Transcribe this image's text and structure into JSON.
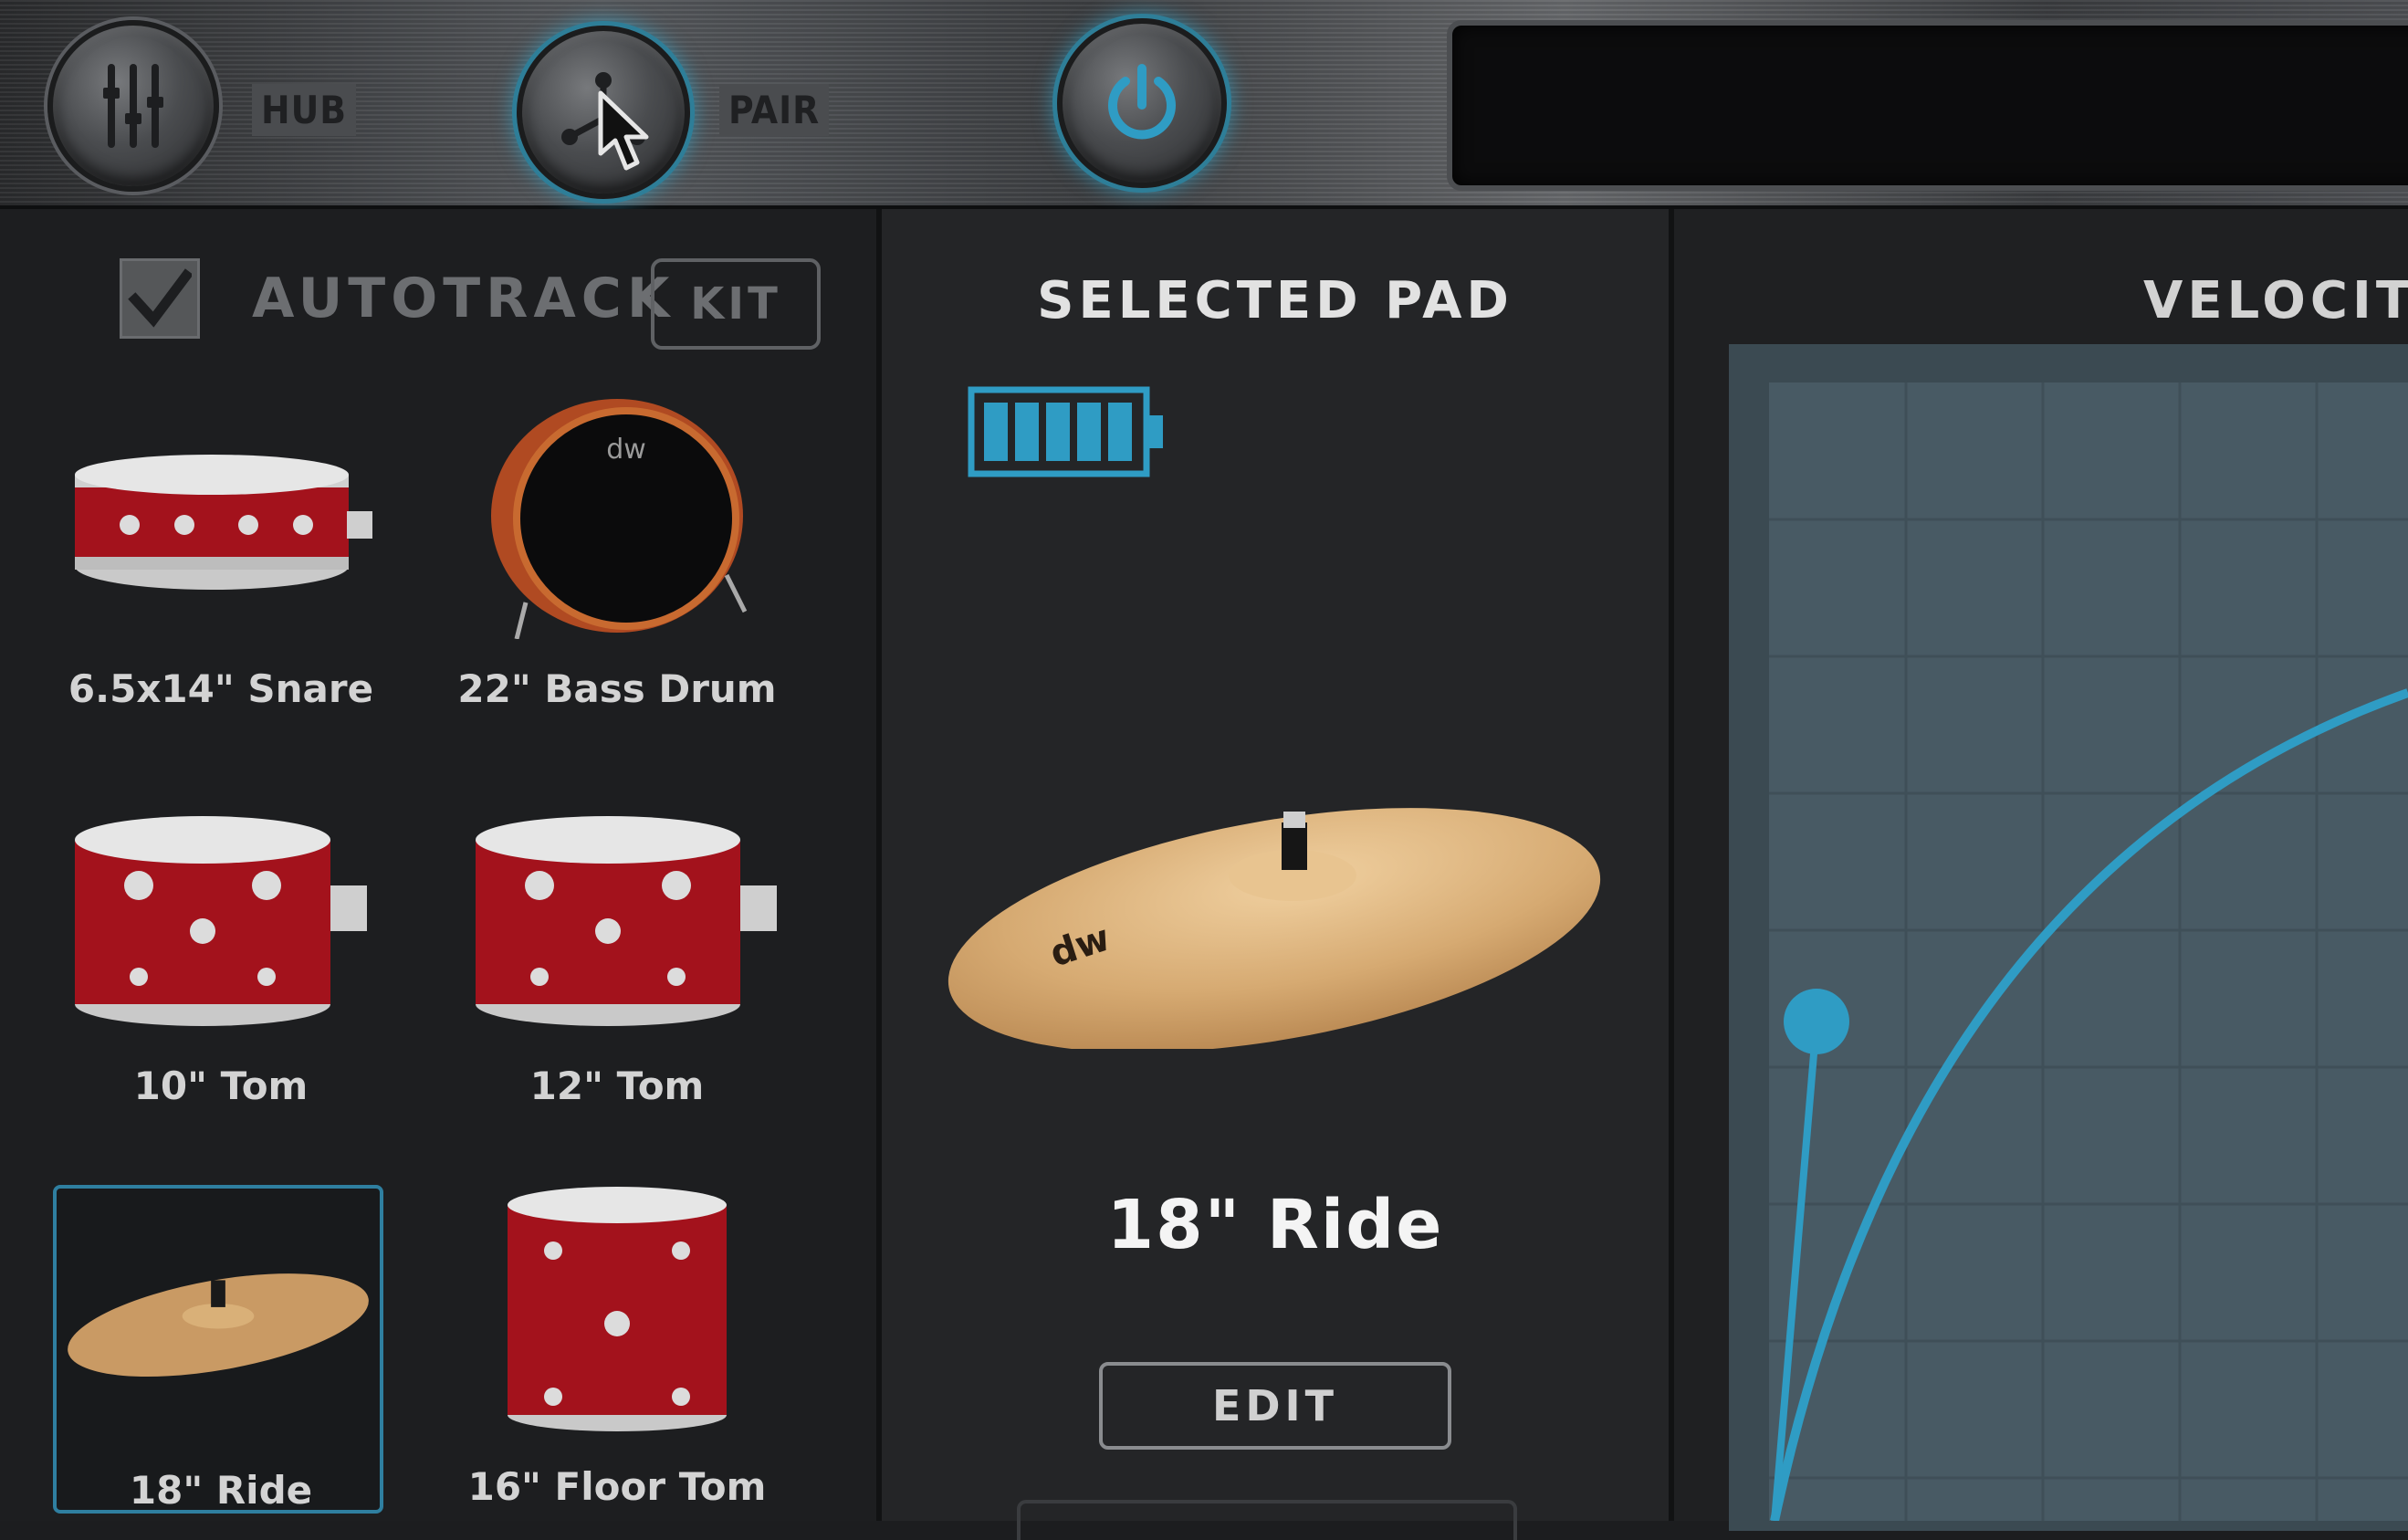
{
  "topbar": {
    "hub_label": "HUB",
    "pair_label": "PAIR",
    "icons": {
      "hub": "mixer-sliders-icon",
      "pair": "network-nodes-icon",
      "power": "power-icon",
      "cursor": "mouse-pointer-icon"
    }
  },
  "autotrack": {
    "label": "AUTOTRACK",
    "checked": true,
    "kit_button": "KIT"
  },
  "pads": [
    {
      "label": "6.5x14\" Snare",
      "type": "snare"
    },
    {
      "label": "22\" Bass Drum",
      "type": "bass-drum"
    },
    {
      "label": "10\" Tom",
      "type": "tom"
    },
    {
      "label": "12\" Tom",
      "type": "tom"
    },
    {
      "label": "18\" Ride",
      "type": "cymbal",
      "selected": true
    },
    {
      "label": "16\" Floor Tom",
      "type": "floor-tom"
    }
  ],
  "selected_pad": {
    "title": "SELECTED PAD",
    "name": "18\" Ride",
    "battery_level": 1.0,
    "edit_button": "EDIT",
    "brand_mark": "dw"
  },
  "velocity": {
    "title": "VELOCITY"
  },
  "colors": {
    "accent": "#2f9cc4",
    "drum_red": "#a3121c",
    "cymbal": "#d6b07a",
    "background": "#1d1e20"
  }
}
